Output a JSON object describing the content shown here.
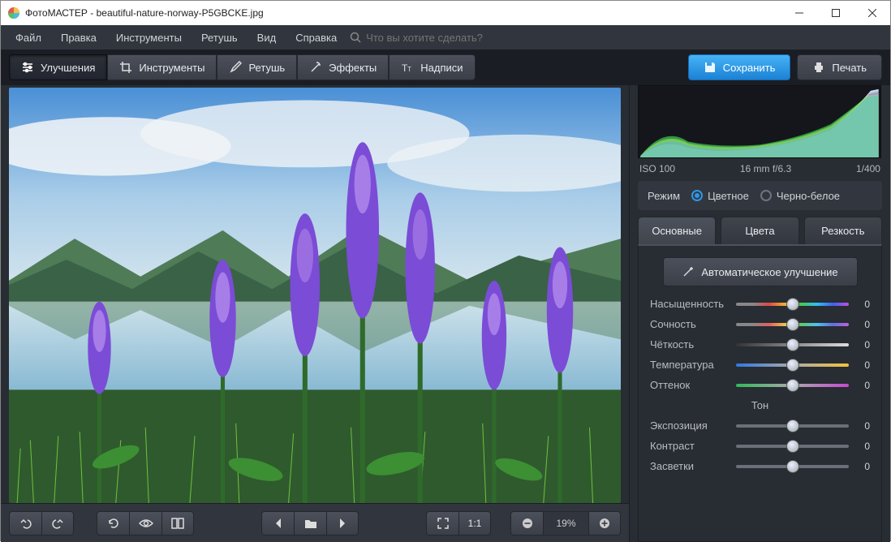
{
  "title": {
    "app": "ФотоМАСТЕР",
    "file": "beautiful-nature-norway-P5GBCKE.jpg"
  },
  "menubar": [
    "Файл",
    "Правка",
    "Инструменты",
    "Ретушь",
    "Вид",
    "Справка"
  ],
  "search": {
    "placeholder": "Что вы хотите сделать?"
  },
  "toolbar": {
    "items": [
      "Улучшения",
      "Инструменты",
      "Ретушь",
      "Эффекты",
      "Надписи"
    ],
    "selected": 0
  },
  "actions": {
    "save": "Сохранить",
    "print": "Печать"
  },
  "zoom": {
    "label": "19%",
    "oneToOne": "1:1"
  },
  "histogram": {
    "iso": "ISO 100",
    "lens": "16 mm f/6.3",
    "shutter": "1/400"
  },
  "mode": {
    "label": "Режим",
    "color": "Цветное",
    "bw": "Черно-белое",
    "selected": "color"
  },
  "tabs": {
    "items": [
      "Основные",
      "Цвета",
      "Резкость"
    ],
    "selected": 0
  },
  "auto": "Автоматическое улучшение",
  "sliders": [
    {
      "name": "Насыщенность",
      "value": 0,
      "grad": "g-sat"
    },
    {
      "name": "Сочность",
      "value": 0,
      "grad": "g-vib"
    },
    {
      "name": "Чёткость",
      "value": 0,
      "grad": "g-clr"
    },
    {
      "name": "Температура",
      "value": 0,
      "grad": "g-temp"
    },
    {
      "name": "Оттенок",
      "value": 0,
      "grad": "g-tint"
    }
  ],
  "tone": {
    "label": "Тон",
    "sliders": [
      {
        "name": "Экспозиция",
        "value": 0,
        "grad": "g-gray"
      },
      {
        "name": "Контраст",
        "value": 0,
        "grad": "g-gray"
      },
      {
        "name": "Засветки",
        "value": 0,
        "grad": "g-gray"
      }
    ]
  }
}
